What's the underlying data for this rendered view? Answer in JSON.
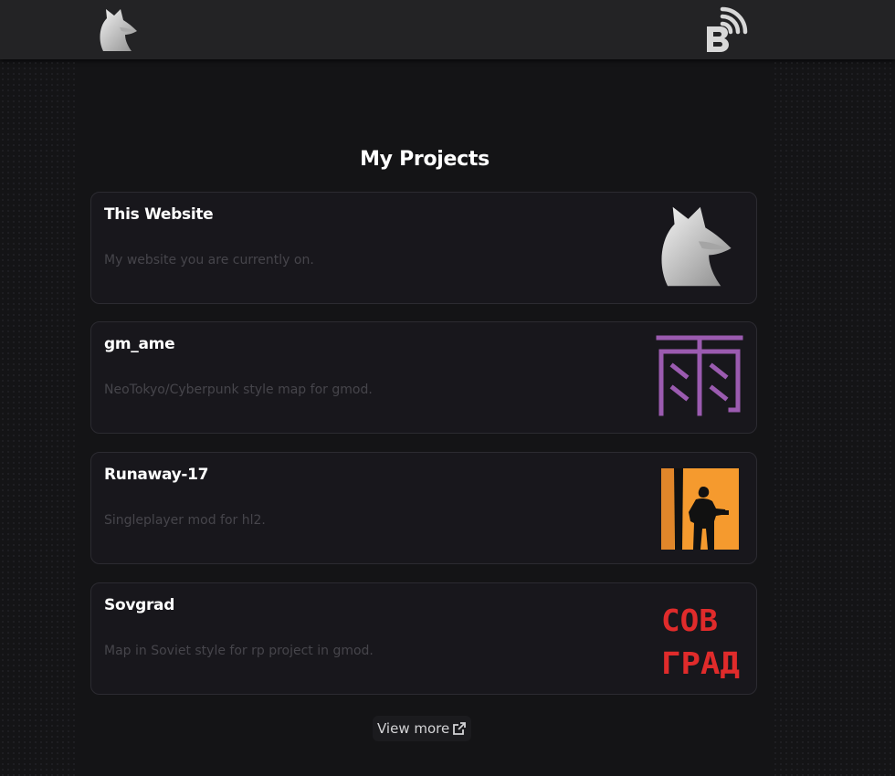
{
  "header": {
    "logo_icon": "fox-logo-icon",
    "blog_icon": "blog-rss-icon"
  },
  "main": {
    "title": "My Projects",
    "projects": [
      {
        "title": "This Website",
        "description": "My website you are currently on.",
        "thumbnail_icon": "fox-logo-icon"
      },
      {
        "title": "gm_ame",
        "description": "NeoTokyo/Cyberpunk style map for gmod.",
        "thumbnail_icon": "rain-kanji-icon",
        "thumbnail_color": "#9b5bb0"
      },
      {
        "title": "Runaway-17",
        "description": "Singleplayer mod for hl2.",
        "thumbnail_icon": "soldier-silhouette-icon",
        "thumbnail_color": "#f59a2e"
      },
      {
        "title": "Sovgrad",
        "description": "Map in Soviet style for rp project in gmod.",
        "thumbnail_icon": "sovgrad-logo-icon",
        "thumbnail_color": "#e02b2b",
        "thumbnail_text": [
          "СОВ",
          "ГРАД"
        ]
      }
    ],
    "view_more": {
      "label": "View more",
      "icon": "external-link-icon"
    }
  },
  "colors": {
    "background": "#141416",
    "header": "#232325",
    "card": "#18171c",
    "card_border": "#2c2b31",
    "text": "#ffffff",
    "muted": "#46454b"
  }
}
